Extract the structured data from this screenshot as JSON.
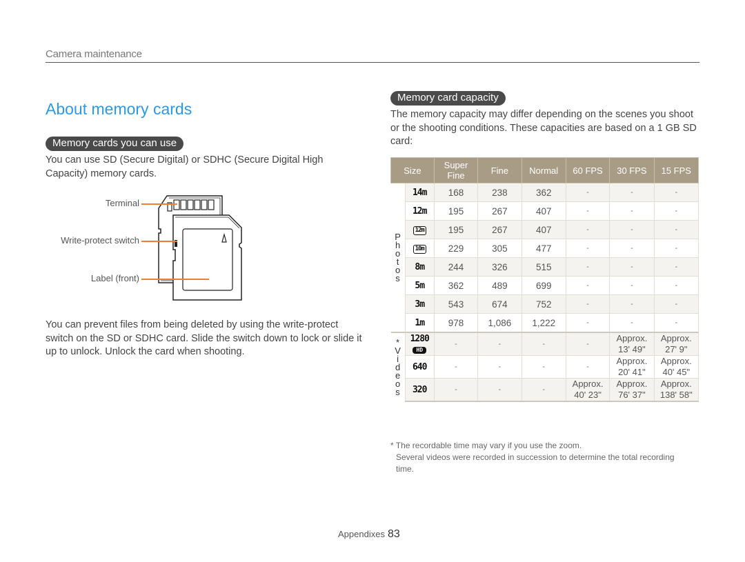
{
  "header": {
    "section": "Camera maintenance"
  },
  "title": "About memory cards",
  "left": {
    "pill": "Memory cards you can use",
    "intro": "You can use SD (Secure Digital) or SDHC (Secure Digital High Capacity) memory cards.",
    "diagram_labels": {
      "terminal": "Terminal",
      "write_protect": "Write-protect switch",
      "label_front": "Label (front)"
    },
    "protect_text": "You can prevent files from being deleted by using the write-protect switch on the SD or SDHC card. Slide the switch down to lock or slide it up to unlock. Unlock the card when shooting."
  },
  "right": {
    "pill": "Memory card capacity",
    "intro": "The memory capacity may differ depending on the scenes you shoot or the shooting conditions. These capacities are based on a 1 GB SD card:",
    "table": {
      "headers": [
        "Size",
        "Super Fine",
        "Fine",
        "Normal",
        "60 FPS",
        "30 FPS",
        "15 FPS"
      ],
      "photos_label": "P h o t o s",
      "videos_label": "* V i d e o s",
      "photos": [
        {
          "size": "14m",
          "icon": "size-14m-icon",
          "cells": [
            "168",
            "238",
            "362",
            "-",
            "-",
            "-"
          ]
        },
        {
          "size": "12m",
          "icon": "size-12m-icon",
          "cells": [
            "195",
            "267",
            "407",
            "-",
            "-",
            "-"
          ]
        },
        {
          "size": "12m",
          "icon": "size-12m-wide-icon",
          "cells": [
            "195",
            "267",
            "407",
            "-",
            "-",
            "-"
          ]
        },
        {
          "size": "10m",
          "icon": "size-10m-icon",
          "cells": [
            "229",
            "305",
            "477",
            "-",
            "-",
            "-"
          ]
        },
        {
          "size": "8m",
          "icon": "size-8m-icon",
          "cells": [
            "244",
            "326",
            "515",
            "-",
            "-",
            "-"
          ]
        },
        {
          "size": "5m",
          "icon": "size-5m-icon",
          "cells": [
            "362",
            "489",
            "699",
            "-",
            "-",
            "-"
          ]
        },
        {
          "size": "3m",
          "icon": "size-3m-icon",
          "cells": [
            "543",
            "674",
            "752",
            "-",
            "-",
            "-"
          ]
        },
        {
          "size": "1m",
          "icon": "size-1m-icon",
          "cells": [
            "978",
            "1,086",
            "1,222",
            "-",
            "-",
            "-"
          ]
        }
      ],
      "videos": [
        {
          "size": "1280",
          "badge": "HD",
          "icon": "size-1280-hd-icon",
          "cells": [
            "-",
            "-",
            "-",
            "-",
            "Approx. 13' 49\"",
            "Approx. 27' 9\""
          ]
        },
        {
          "size": "640",
          "icon": "size-640-icon",
          "cells": [
            "-",
            "-",
            "-",
            "-",
            "Approx. 20' 41\"",
            "Approx. 40' 45\""
          ]
        },
        {
          "size": "320",
          "icon": "size-320-icon",
          "cells": [
            "-",
            "-",
            "-",
            "Approx. 40' 23\"",
            "Approx. 76' 37\"",
            "Approx. 138' 58\""
          ]
        }
      ]
    },
    "footnote_1": "* The recordable time may vary if you use the zoom.",
    "footnote_2": "Several videos were recorded in succession to determine the total recording time."
  },
  "footer": {
    "label": "Appendixes",
    "page": "83"
  },
  "colors": {
    "accent": "#2a9ae6",
    "header_bg": "#a89c86",
    "leader": "#ef7d32",
    "pill_bg": "#4a4a4a"
  }
}
